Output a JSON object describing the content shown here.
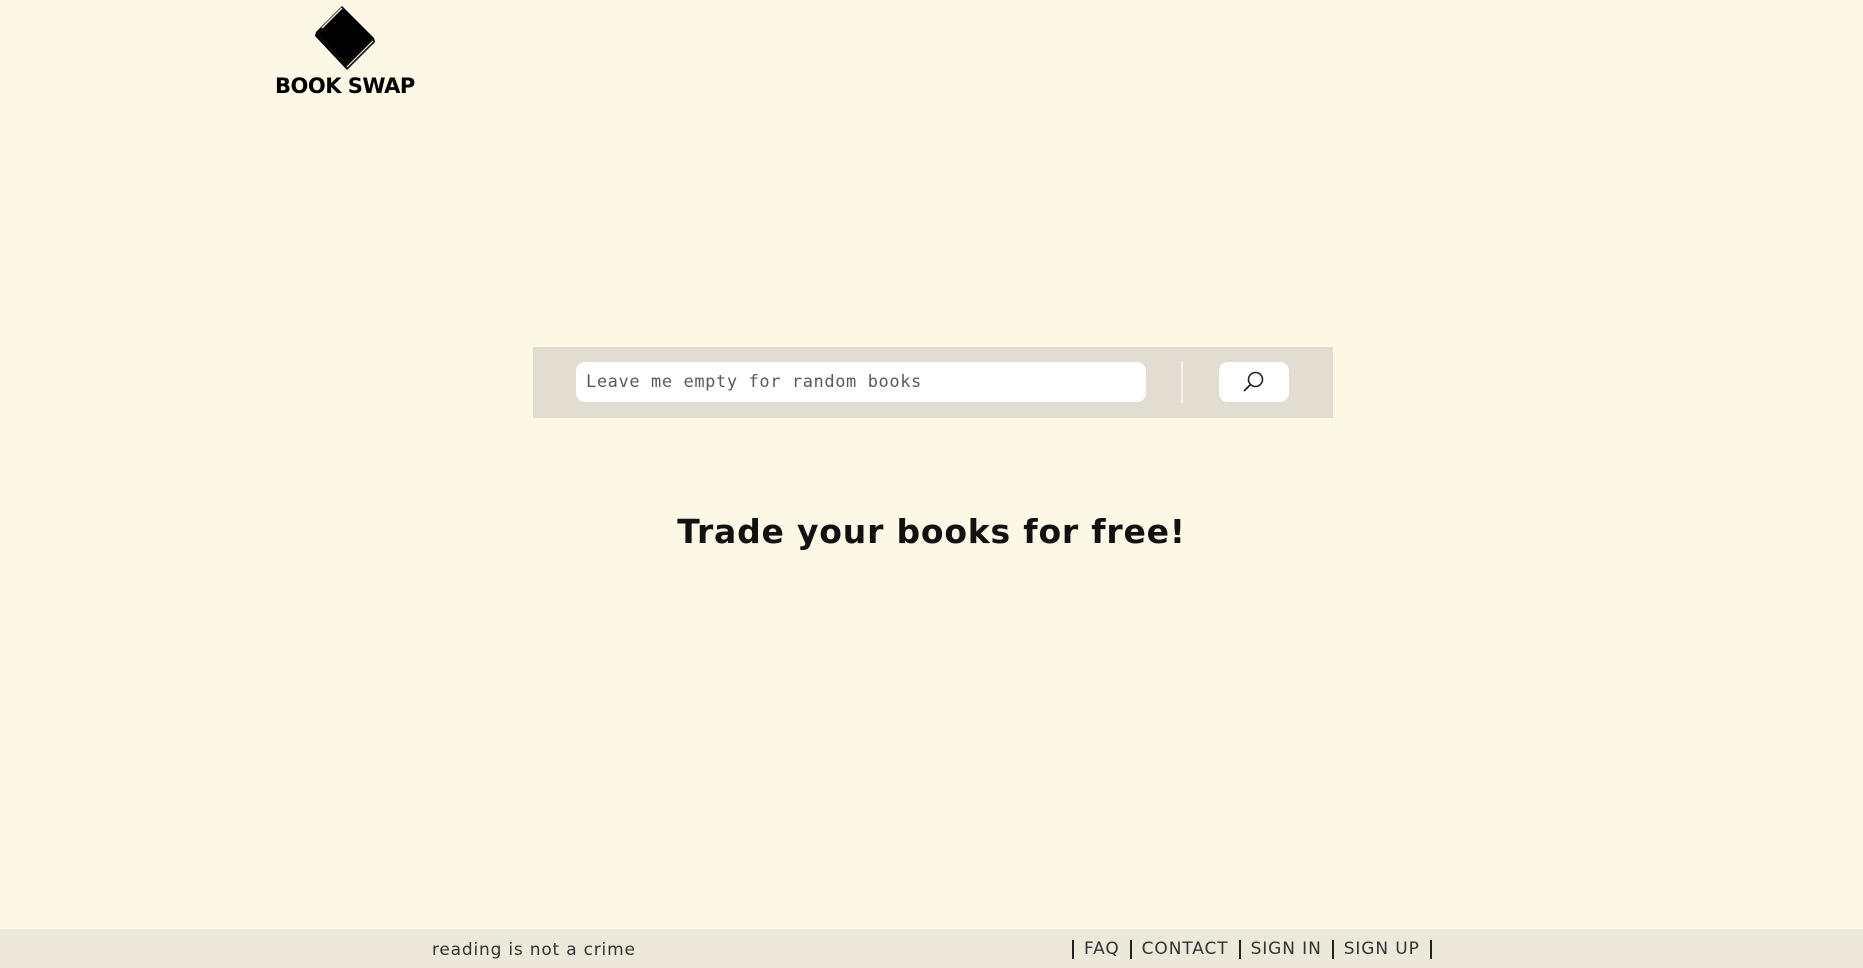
{
  "brand": {
    "name": "BOOK SWAP",
    "icon": "book-icon"
  },
  "search": {
    "placeholder": "Leave me empty for random books",
    "value": "",
    "button_icon": "search-icon"
  },
  "headline": "Trade your books for free!",
  "footer": {
    "tagline": "reading is not a crime",
    "links": [
      "FAQ",
      "CONTACT",
      "SIGN IN",
      "SIGN UP"
    ]
  },
  "colors": {
    "page_background": "#fdf7e6",
    "search_panel": "#e1ddd1",
    "footer_background": "#ece9da",
    "text": "#111111"
  }
}
